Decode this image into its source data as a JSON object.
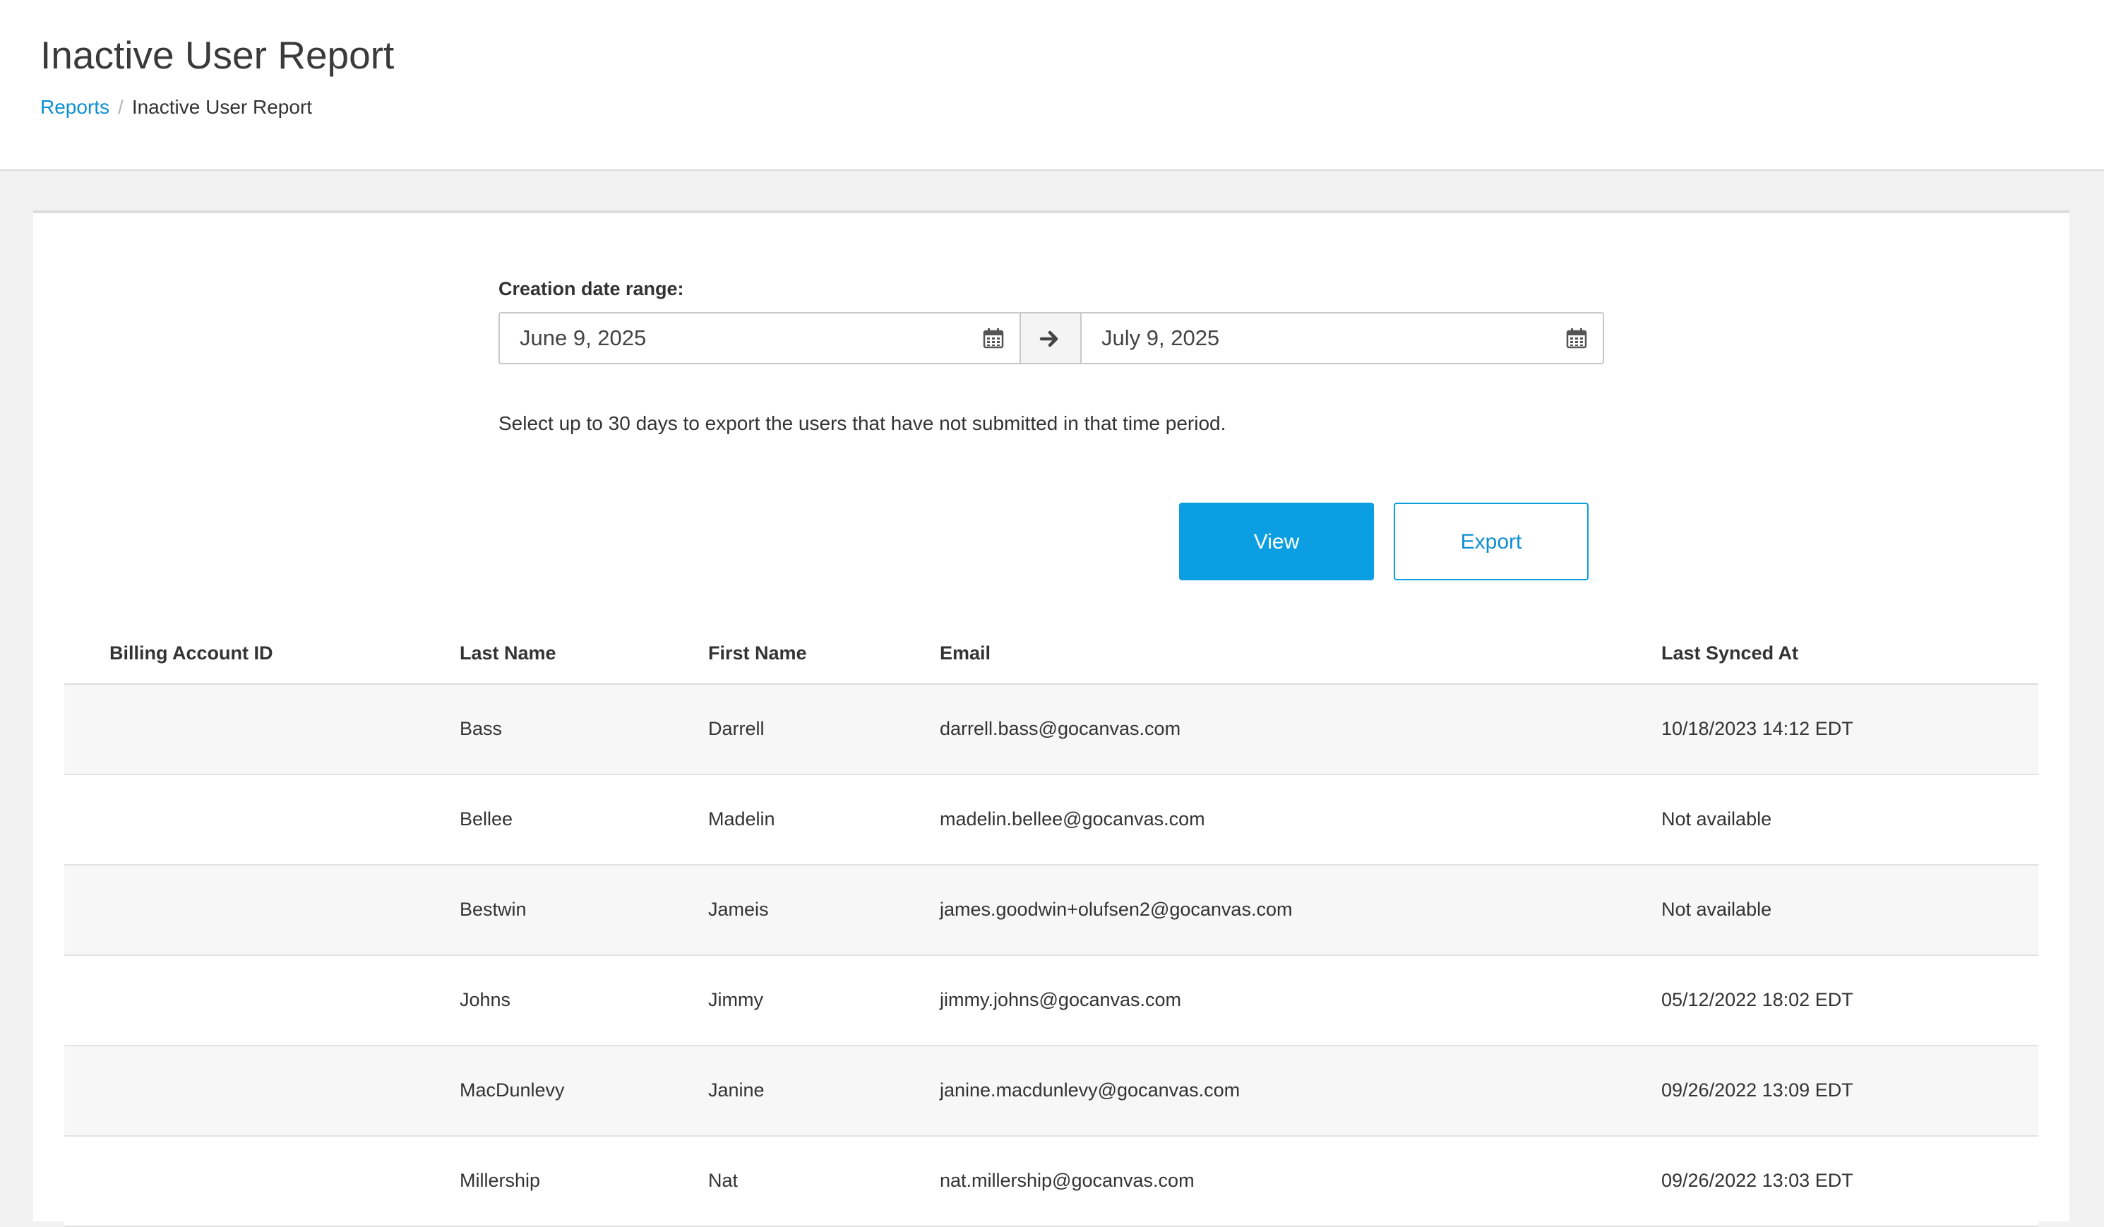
{
  "header": {
    "title": "Inactive User Report",
    "breadcrumb": {
      "parent": "Reports",
      "separator": "/",
      "current": "Inactive User Report"
    }
  },
  "filters": {
    "range_label": "Creation date range:",
    "start_date": "June 9, 2025",
    "end_date": "July 9, 2025",
    "start_icon": "calendar-icon",
    "separator_icon": "arrow-right-icon",
    "end_icon": "calendar-icon",
    "help_text": "Select up to 30 days to export the users that have not submitted in that time period."
  },
  "actions": {
    "view_label": "View",
    "export_label": "Export"
  },
  "colors": {
    "accent": "#0b9ee3",
    "link": "#0b8fd3",
    "row_stripe": "#f7f7f7"
  },
  "table": {
    "columns": [
      "Billing Account ID",
      "Last Name",
      "First Name",
      "Email",
      "Last Synced At"
    ],
    "rows": [
      {
        "billing_account_id": "",
        "last_name": "Bass",
        "first_name": "Darrell",
        "email": "darrell.bass@gocanvas.com",
        "last_synced_at": "10/18/2023 14:12 EDT"
      },
      {
        "billing_account_id": "",
        "last_name": "Bellee",
        "first_name": "Madelin",
        "email": "madelin.bellee@gocanvas.com",
        "last_synced_at": "Not available"
      },
      {
        "billing_account_id": "",
        "last_name": "Bestwin",
        "first_name": "Jameis",
        "email": "james.goodwin+olufsen2@gocanvas.com",
        "last_synced_at": "Not available"
      },
      {
        "billing_account_id": "",
        "last_name": "Johns",
        "first_name": "Jimmy",
        "email": "jimmy.johns@gocanvas.com",
        "last_synced_at": "05/12/2022 18:02 EDT"
      },
      {
        "billing_account_id": "",
        "last_name": "MacDunlevy",
        "first_name": "Janine",
        "email": "janine.macdunlevy@gocanvas.com",
        "last_synced_at": "09/26/2022 13:09 EDT"
      },
      {
        "billing_account_id": "",
        "last_name": "Millership",
        "first_name": "Nat",
        "email": "nat.millership@gocanvas.com",
        "last_synced_at": "09/26/2022 13:03 EDT"
      }
    ]
  }
}
